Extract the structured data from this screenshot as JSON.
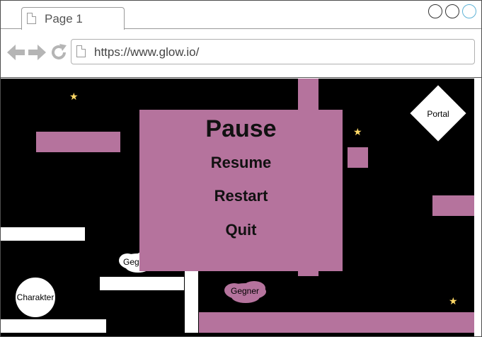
{
  "browser": {
    "tab_title": "Page 1",
    "url": "https://www.glow.io/",
    "icons": [
      "back-arrow-icon",
      "forward-arrow-icon",
      "reload-icon",
      "page-icon"
    ]
  },
  "pause_menu": {
    "title": "Pause",
    "items": [
      "Resume",
      "Restart",
      "Quit"
    ]
  },
  "game": {
    "portal_label": "Portal",
    "character_label": "Charakter",
    "enemy_labels": [
      "Gegner",
      "Gegner"
    ]
  },
  "colors": {
    "background": "#000000",
    "platform_pink": "#b5739d",
    "platform_white": "#ffffff",
    "star": "#ffd966"
  }
}
